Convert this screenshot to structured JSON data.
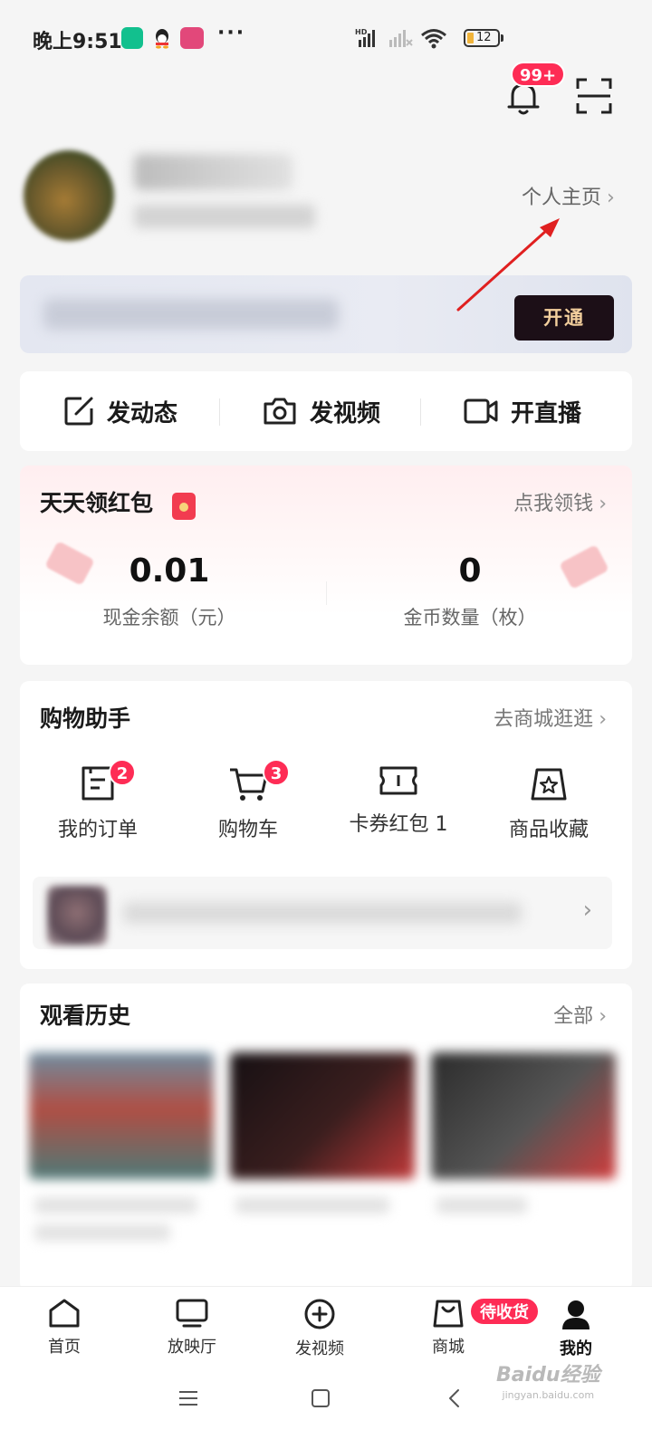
{
  "status_bar": {
    "time": "晚上9:51",
    "more": "···",
    "battery": "12"
  },
  "top": {
    "notification_badge": "99+"
  },
  "profile": {
    "homepage_link": "个人主页",
    "chevron": "›"
  },
  "vip": {
    "open_button": "开通"
  },
  "actions": [
    {
      "label": "发动态",
      "icon": "edit-icon"
    },
    {
      "label": "发视频",
      "icon": "camera-icon"
    },
    {
      "label": "开直播",
      "icon": "video-camera-icon"
    }
  ],
  "red_packet": {
    "title": "天天领红包",
    "link": "点我领钱",
    "cash_value": "0.01",
    "cash_label": "现金余额（元）",
    "coin_value": "0",
    "coin_label": "金币数量（枚）"
  },
  "shopping": {
    "title": "购物助手",
    "link": "去商城逛逛",
    "items": [
      {
        "label": "我的订单",
        "count": "2",
        "icon": "order-icon"
      },
      {
        "label": "购物车",
        "count": "3",
        "icon": "cart-icon"
      },
      {
        "label": "卡券红包 1",
        "count": "",
        "icon": "coupon-icon"
      },
      {
        "label": "商品收藏",
        "count": "",
        "icon": "favorite-bag-icon"
      }
    ]
  },
  "history": {
    "title": "观看历史",
    "link": "全部"
  },
  "bottom_nav": {
    "items": [
      {
        "label": "首页",
        "icon": "home-icon"
      },
      {
        "label": "放映厅",
        "icon": "tv-icon"
      },
      {
        "label": "发视频",
        "icon": "plus-circle-icon"
      },
      {
        "label": "商城",
        "icon": "shopping-bag-icon"
      },
      {
        "label": "我的",
        "icon": "user-icon"
      }
    ],
    "active": "我的",
    "pending_badge": "待收货"
  },
  "watermark": {
    "brand": "Baidu经验",
    "url": "jingyan.baidu.com"
  },
  "colors": {
    "accent": "#fe2c55",
    "vip_button_bg": "#1c0f17",
    "vip_button_text": "#f3cf9d",
    "annotation_arrow": "#e02020"
  }
}
